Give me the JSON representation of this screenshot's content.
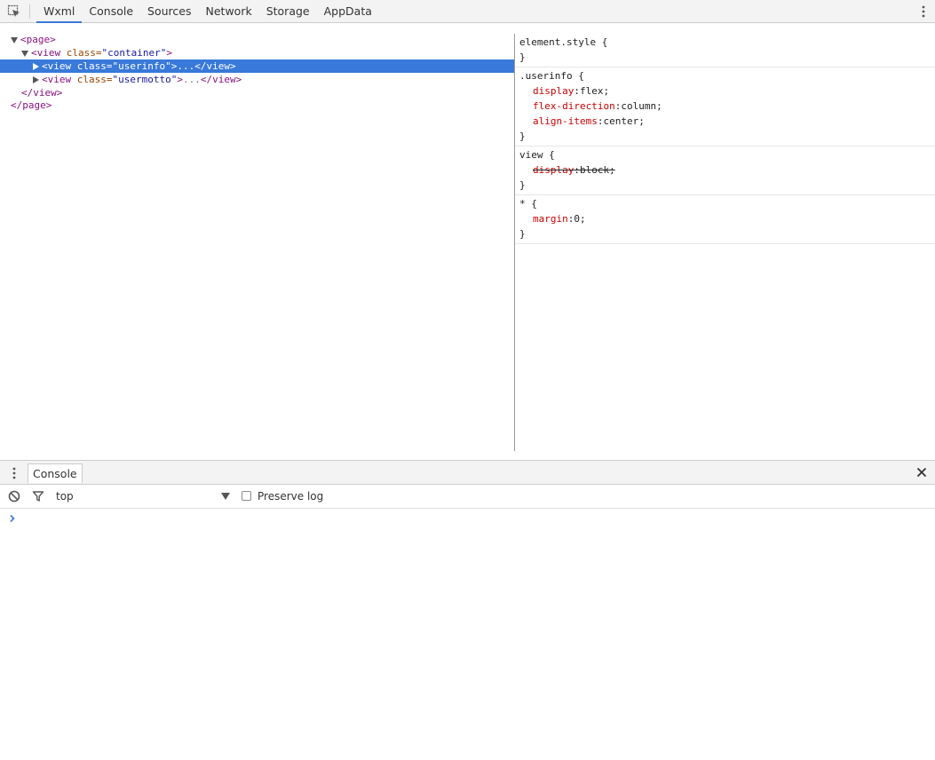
{
  "toolbar": {
    "tabs": [
      "Wxml",
      "Console",
      "Sources",
      "Network",
      "Storage",
      "AppData"
    ],
    "active_tab": "Wxml"
  },
  "tree": {
    "l1_tag": "<page>",
    "l2_open": "<view",
    "l2_attr": "class=",
    "l2_val": "\"container\"",
    "l2_close": ">",
    "l3_open": "<view",
    "l3_attr": "class=",
    "l3_val": "\"userinfo\"",
    "l3_close": ">",
    "l3_ell": "...",
    "l3_end": "</view>",
    "l4_open": "<view",
    "l4_attr": "class=",
    "l4_val": "\"usermotto\"",
    "l4_close": ">",
    "l4_ell": "...",
    "l4_end": "</view>",
    "l5_tag": "</view>",
    "l6_tag": "</page>"
  },
  "styles": {
    "r1_selector": "element.style {",
    "r1_close": "}",
    "r2_selector": ".userinfo {",
    "r2_p1_name": "display",
    "r2_p1_val": ":flex;",
    "r2_p2_name": "flex-direction",
    "r2_p2_val": ":column;",
    "r2_p3_name": "align-items",
    "r2_p3_val": ":center;",
    "r2_close": "}",
    "r3_selector": "view {",
    "r3_p1_name": "display",
    "r3_p1_val": ":block;",
    "r3_close": "}",
    "r4_selector": "* {",
    "r4_p1_name": "margin",
    "r4_p1_val": ":0;",
    "r4_close": "}"
  },
  "drawer": {
    "tab_label": "Console",
    "context": "top",
    "preserve_log": "Preserve log",
    "preserve_checked": false
  },
  "colors": {
    "accent": "#3879d9",
    "tag": "#881280",
    "attr": "#994500",
    "value": "#1a1aa6",
    "property": "#c80000"
  }
}
